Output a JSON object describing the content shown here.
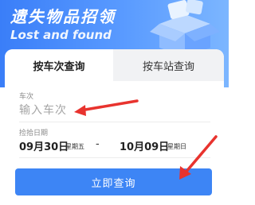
{
  "banner": {
    "title": "遗失物品招领",
    "subtitle": "Lost and found"
  },
  "tabs": [
    {
      "label": "按车次查询",
      "active": true
    },
    {
      "label": "按车站查询",
      "active": false
    }
  ],
  "train_field": {
    "label": "车次",
    "placeholder": "输入车次"
  },
  "date_field": {
    "label": "捡拾日期",
    "start_date": "09月30日",
    "start_weekday": "星期五",
    "separator": "-",
    "end_date": "10月09日",
    "end_weekday": "星期日"
  },
  "submit_label": "立即查询",
  "colors": {
    "primary": "#3d85f5",
    "annotation_arrow": "#e8332e"
  },
  "icons": [
    "box-illustration-icon",
    "arrow-annotation-icon"
  ]
}
